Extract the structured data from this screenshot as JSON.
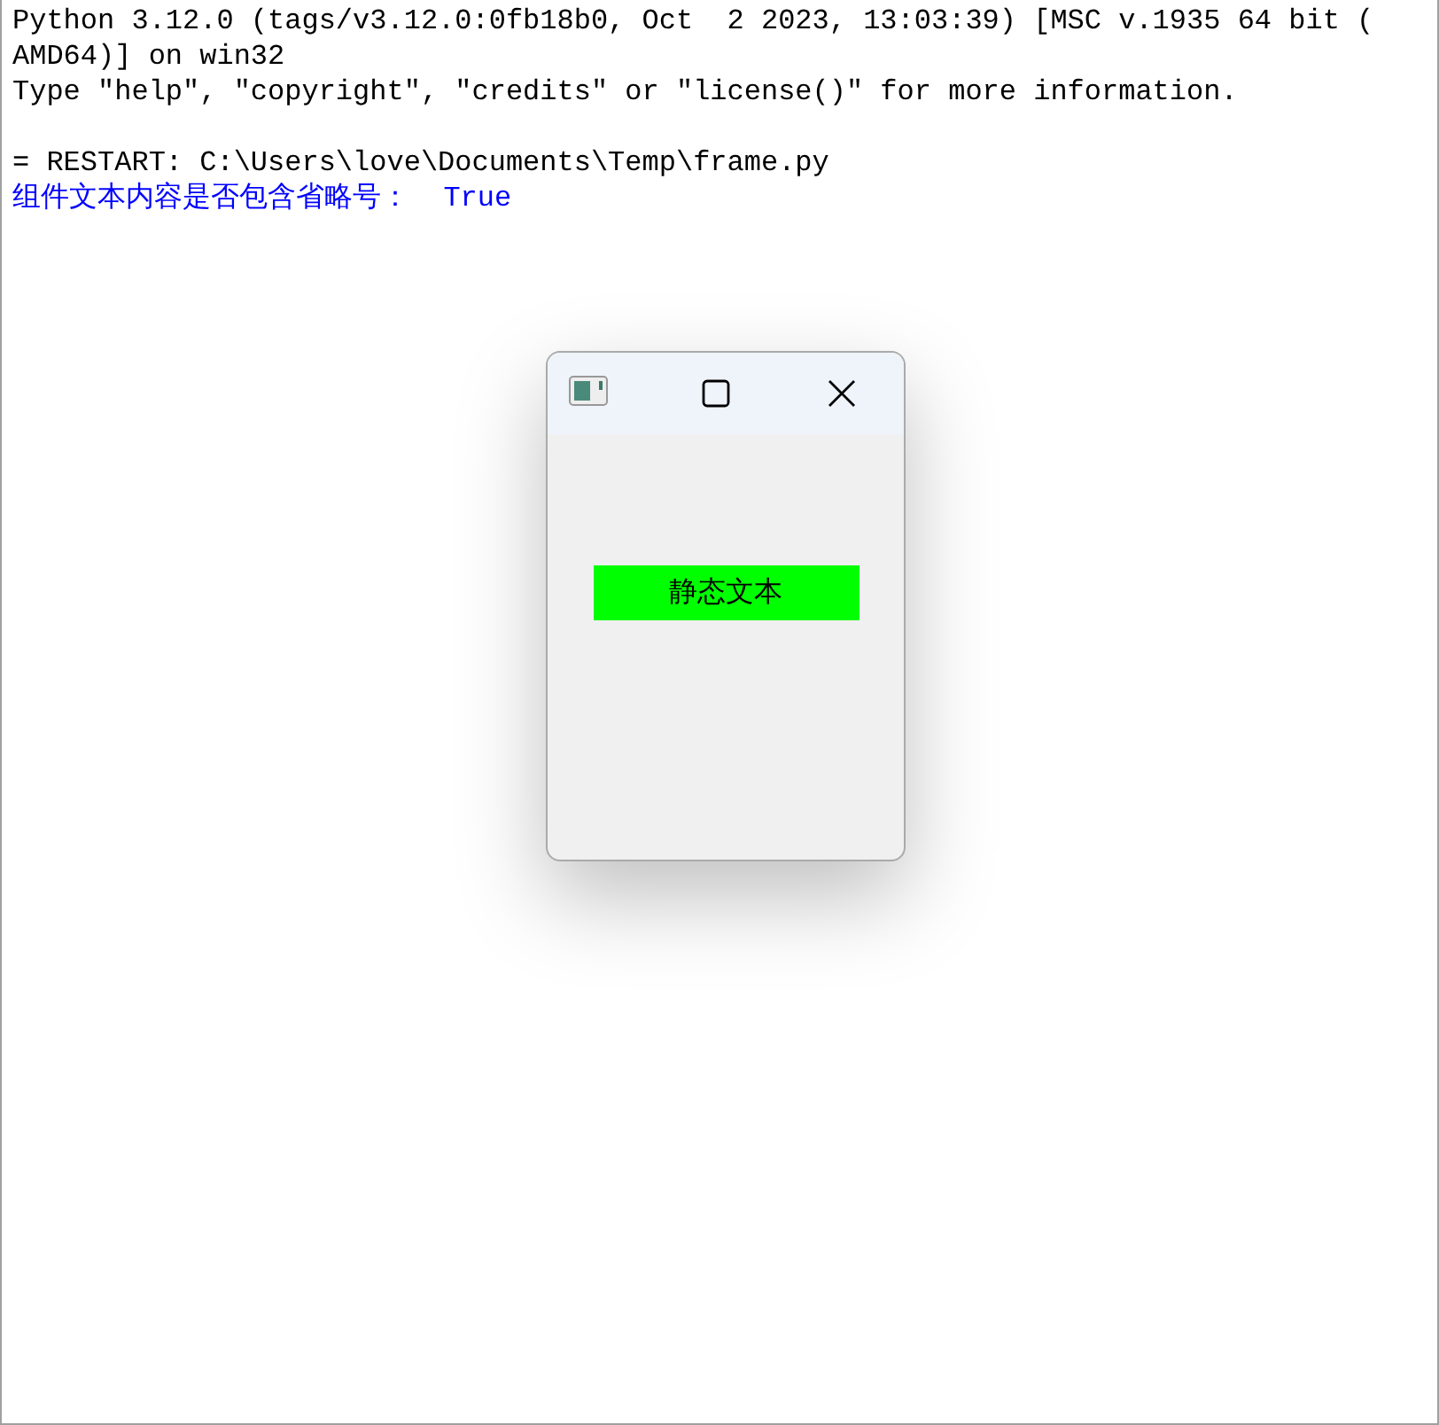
{
  "shell": {
    "lines": [
      {
        "kind": "output",
        "text": "Python 3.12.0 (tags/v3.12.0:0fb18b0, Oct  2 2023, 13:03:39) [MSC v.1935 64 bit ("
      },
      {
        "kind": "output",
        "text": "AMD64)] on win32"
      },
      {
        "kind": "output",
        "text": "Type \"help\", \"copyright\", \"credits\" or \"license()\" for more information."
      },
      {
        "kind": "blank"
      },
      {
        "kind": "output",
        "text": "= RESTART: C:\\Users\\love\\Documents\\Temp\\frame.py"
      },
      {
        "kind": "stdout",
        "text": "组件文本内容是否包含省略号：  True"
      }
    ]
  },
  "frame": {
    "static_text": {
      "text": "静态文本",
      "color": "#00ff00"
    }
  }
}
